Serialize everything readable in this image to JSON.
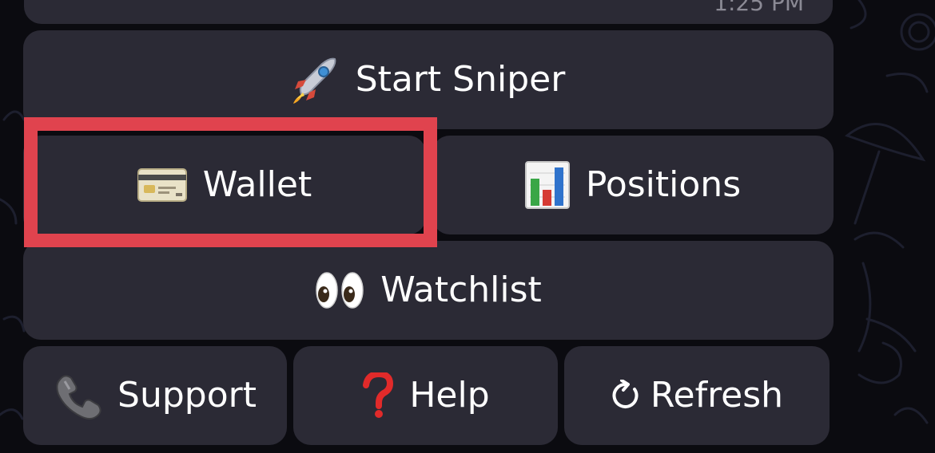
{
  "message": {
    "time": "1:25 PM"
  },
  "keyboard": {
    "start_sniper": {
      "emoji": "🚀",
      "label": "Start Sniper"
    },
    "wallet": {
      "emoji": "💳",
      "label": "Wallet"
    },
    "positions": {
      "emoji": "📊",
      "label": "Positions"
    },
    "watchlist": {
      "emoji": "👀",
      "label": "Watchlist"
    },
    "support": {
      "emoji": "📞",
      "label": "Support"
    },
    "help": {
      "emoji": "❓",
      "label": "Help"
    },
    "refresh": {
      "emoji": "↻",
      "label": "Refresh"
    }
  },
  "colors": {
    "background": "#0b0b10",
    "button": "#2b2a35",
    "text": "#ffffff",
    "highlight": "#e0434e"
  }
}
